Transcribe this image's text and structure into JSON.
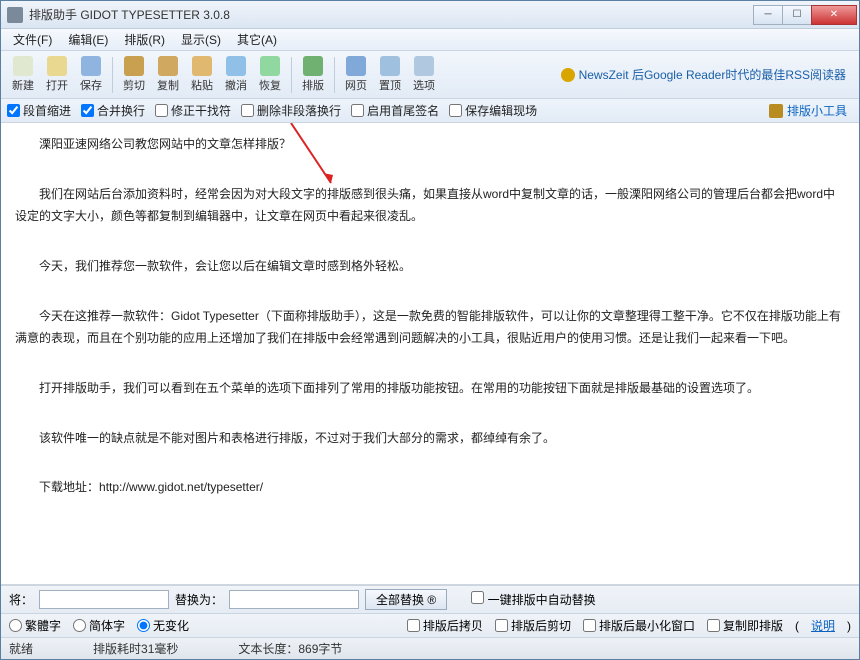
{
  "window": {
    "title": "排版助手 GIDOT TYPESETTER 3.0.8"
  },
  "menu": {
    "file": "文件(F)",
    "edit": "编辑(E)",
    "layout": "排版(R)",
    "show": "显示(S)",
    "other": "其它(A)"
  },
  "toolbar": {
    "new": "新建",
    "open": "打开",
    "save": "保存",
    "cut": "剪切",
    "copy": "复制",
    "paste": "粘贴",
    "undo": "撤消",
    "redo": "恢复",
    "typeset": "排版",
    "web": "网页",
    "home": "置顶",
    "options": "选项",
    "news_prefix": "NewsZeit 后Google Reader时代的最佳RSS阅读器"
  },
  "opts": {
    "para_indent": "段首缩进",
    "merge_wrap": "合并换行",
    "trim_fix": "修正干找符",
    "del_nonpara": "删除非段落换行",
    "enable_sign": "启用首尾签名",
    "keep_scene": "保存编辑现场",
    "tools": "排版小工具"
  },
  "article": {
    "p1": "溧阳亚速网络公司教您网站中的文章怎样排版？",
    "p2": "我们在网站后台添加资料时，经常会因为对大段文字的排版感到很头痛，如果直接从word中复制文章的话，一般溧阳网络公司的管理后台都会把word中设定的文字大小，颜色等都复制到编辑器中，让文章在网页中看起来很凌乱。",
    "p3": "今天，我们推荐您一款软件，会让您以后在编辑文章时感到格外轻松。",
    "p4": "今天在这推荐一款软件：Gidot Typesetter（下面称排版助手），这是一款免费的智能排版软件，可以让你的文章整理得工整干净。它不仅在排版功能上有满意的表现，而且在个别功能的应用上还增加了我们在排版中会经常遇到问题解决的小工具，很贴近用户的使用习惯。还是让我们一起来看一下吧。",
    "p5": "打开排版助手，我们可以看到在五个菜单的选项下面排列了常用的排版功能按钮。在常用的功能按钮下面就是排版最基础的设置选项了。",
    "p6": "该软件唯一的缺点就是不能对图片和表格进行排版，不过对于我们大部分的需求，都绰绰有余了。",
    "p7_label": "下载地址：",
    "p7_url": "http://www.gidot.net/typesetter/"
  },
  "replace": {
    "find_label": "将：",
    "replace_label": "替换为：",
    "all_btn": "全部替换 ®",
    "auto_chk": "一键排版中自动替换"
  },
  "radios": {
    "trad": "繁體字",
    "simp": "简体字",
    "none": "无变化",
    "after_copy": "排版后拷贝",
    "after_cut": "排版后剪切",
    "after_min": "排版后最小化窗口",
    "copy_then": "复制即排版",
    "help": "说明"
  },
  "status": {
    "ready": "就绪",
    "elapsed": "排版耗时31毫秒",
    "length": "文本长度：869字节"
  }
}
